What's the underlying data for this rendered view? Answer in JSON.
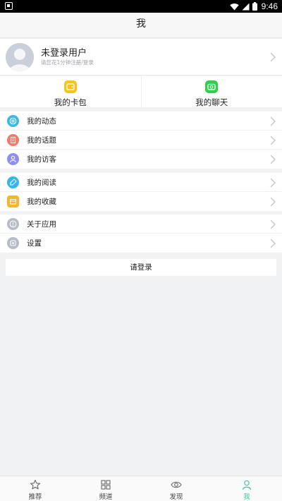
{
  "status_bar": {
    "time": "9:46"
  },
  "header": {
    "title": "我"
  },
  "profile": {
    "name": "未登录用户",
    "subtitle": "请您花1分钟注册/登录"
  },
  "quick_actions": [
    {
      "label": "我的卡包",
      "icon": "wallet-icon",
      "color": "#f5c518"
    },
    {
      "label": "我的聊天",
      "icon": "chat-icon",
      "color": "#2fcf4a"
    }
  ],
  "menu_groups": [
    [
      {
        "label": "我的动态",
        "icon": "at-icon",
        "color": "#3bb7e8"
      },
      {
        "label": "我的话题",
        "icon": "topic-icon",
        "color": "#f07a6a"
      },
      {
        "label": "我的访客",
        "icon": "visitor-icon",
        "color": "#8f8ff2"
      }
    ],
    [
      {
        "label": "我的阅读",
        "icon": "read-icon",
        "color": "#35b6e8"
      },
      {
        "label": "我的收藏",
        "icon": "favorite-icon",
        "color": "#f5b62b"
      }
    ],
    [
      {
        "label": "关于应用",
        "icon": "info-icon",
        "color": "#b5bcc6"
      },
      {
        "label": "设置",
        "icon": "settings-icon",
        "color": "#b5bcc6"
      }
    ]
  ],
  "login_button": "请登录",
  "tabs": [
    {
      "label": "推荐",
      "icon": "star-icon",
      "active": false
    },
    {
      "label": "频道",
      "icon": "grid-icon",
      "active": false
    },
    {
      "label": "发现",
      "icon": "eye-icon",
      "active": false
    },
    {
      "label": "我",
      "icon": "person-icon",
      "active": true
    }
  ],
  "colors": {
    "accent": "#3cc4a3",
    "background": "#f1f2f4"
  }
}
